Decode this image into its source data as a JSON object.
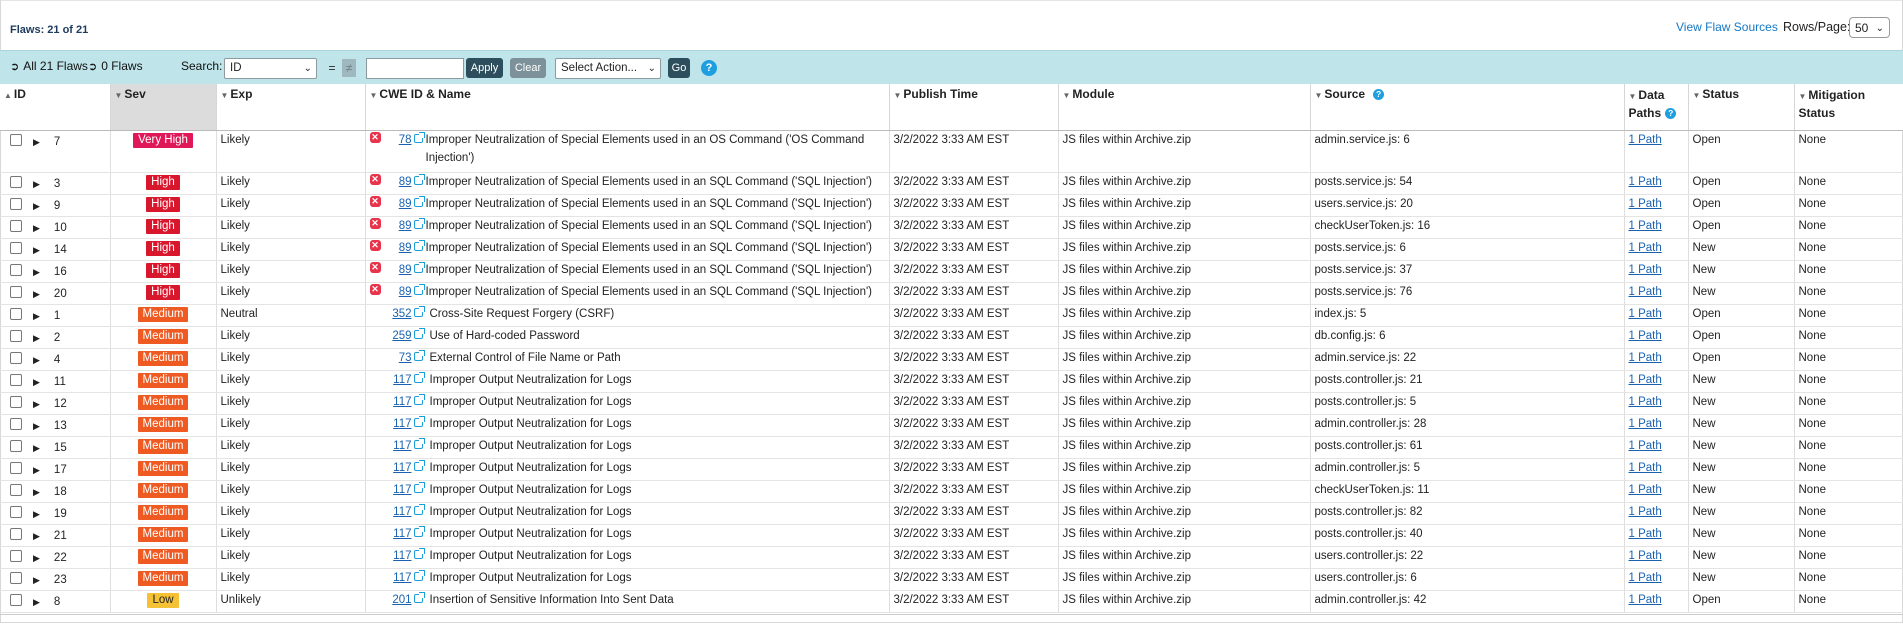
{
  "header": {
    "flaw_count": "Flaws: 21 of 21",
    "view_flaw_sources": "View Flaw Sources",
    "rows_per_page_label": "Rows/Page:",
    "rows_per_page_value": "50"
  },
  "toolbar": {
    "all_flaws": "All 21 Flaws",
    "zero_flaws": "0 Flaws",
    "search_label": "Search:",
    "search_field": "ID",
    "eq": "=",
    "neq": "≠",
    "apply": "Apply",
    "clear": "Clear",
    "action": "Select Action...",
    "go": "Go",
    "help": "?"
  },
  "columns": {
    "id": "ID",
    "sev": "Sev",
    "exp": "Exp",
    "cwe": "CWE ID & Name",
    "publish": "Publish Time",
    "module": "Module",
    "source": "Source",
    "paths": "Data Paths",
    "status": "Status",
    "mitigation": "Mitigation Status"
  },
  "rows": [
    {
      "id": "7",
      "sev": "Very High",
      "sevclass": "veryhigh",
      "exp": "Likely",
      "cwe": "78",
      "xicon": true,
      "name": "Improper Neutralization of Special Elements used in an OS Command ('OS Command Injection')",
      "time": "3/2/2022 3:33 AM EST",
      "module": "JS files within Archive.zip",
      "source": "admin.service.js: 6",
      "path": "1 Path",
      "status": "Open",
      "mit": "None"
    },
    {
      "id": "3",
      "sev": "High",
      "sevclass": "high",
      "exp": "Likely",
      "cwe": "89",
      "xicon": true,
      "name": "Improper Neutralization of Special Elements used in an SQL Command ('SQL Injection')",
      "time": "3/2/2022 3:33 AM EST",
      "module": "JS files within Archive.zip",
      "source": "posts.service.js: 54",
      "path": "1 Path",
      "status": "Open",
      "mit": "None"
    },
    {
      "id": "9",
      "sev": "High",
      "sevclass": "high",
      "exp": "Likely",
      "cwe": "89",
      "xicon": true,
      "name": "Improper Neutralization of Special Elements used in an SQL Command ('SQL Injection')",
      "time": "3/2/2022 3:33 AM EST",
      "module": "JS files within Archive.zip",
      "source": "users.service.js: 20",
      "path": "1 Path",
      "status": "Open",
      "mit": "None"
    },
    {
      "id": "10",
      "sev": "High",
      "sevclass": "high",
      "exp": "Likely",
      "cwe": "89",
      "xicon": true,
      "name": "Improper Neutralization of Special Elements used in an SQL Command ('SQL Injection')",
      "time": "3/2/2022 3:33 AM EST",
      "module": "JS files within Archive.zip",
      "source": "checkUserToken.js: 16",
      "path": "1 Path",
      "status": "Open",
      "mit": "None"
    },
    {
      "id": "14",
      "sev": "High",
      "sevclass": "high",
      "exp": "Likely",
      "cwe": "89",
      "xicon": true,
      "name": "Improper Neutralization of Special Elements used in an SQL Command ('SQL Injection')",
      "time": "3/2/2022 3:33 AM EST",
      "module": "JS files within Archive.zip",
      "source": "posts.service.js: 6",
      "path": "1 Path",
      "status": "New",
      "mit": "None"
    },
    {
      "id": "16",
      "sev": "High",
      "sevclass": "high",
      "exp": "Likely",
      "cwe": "89",
      "xicon": true,
      "name": "Improper Neutralization of Special Elements used in an SQL Command ('SQL Injection')",
      "time": "3/2/2022 3:33 AM EST",
      "module": "JS files within Archive.zip",
      "source": "posts.service.js: 37",
      "path": "1 Path",
      "status": "New",
      "mit": "None"
    },
    {
      "id": "20",
      "sev": "High",
      "sevclass": "high",
      "exp": "Likely",
      "cwe": "89",
      "xicon": true,
      "name": "Improper Neutralization of Special Elements used in an SQL Command ('SQL Injection')",
      "time": "3/2/2022 3:33 AM EST",
      "module": "JS files within Archive.zip",
      "source": "posts.service.js: 76",
      "path": "1 Path",
      "status": "New",
      "mit": "None"
    },
    {
      "id": "1",
      "sev": "Medium",
      "sevclass": "medium",
      "exp": "Neutral",
      "cwe": "352",
      "xicon": false,
      "name": "Cross-Site Request Forgery (CSRF)",
      "time": "3/2/2022 3:33 AM EST",
      "module": "JS files within Archive.zip",
      "source": "index.js: 5",
      "path": "1 Path",
      "status": "Open",
      "mit": "None"
    },
    {
      "id": "2",
      "sev": "Medium",
      "sevclass": "medium",
      "exp": "Likely",
      "cwe": "259",
      "xicon": false,
      "name": "Use of Hard-coded Password",
      "time": "3/2/2022 3:33 AM EST",
      "module": "JS files within Archive.zip",
      "source": "db.config.js: 6",
      "path": "1 Path",
      "status": "Open",
      "mit": "None"
    },
    {
      "id": "4",
      "sev": "Medium",
      "sevclass": "medium",
      "exp": "Likely",
      "cwe": "73",
      "xicon": false,
      "name": "External Control of File Name or Path",
      "time": "3/2/2022 3:33 AM EST",
      "module": "JS files within Archive.zip",
      "source": "admin.service.js: 22",
      "path": "1 Path",
      "status": "Open",
      "mit": "None"
    },
    {
      "id": "11",
      "sev": "Medium",
      "sevclass": "medium",
      "exp": "Likely",
      "cwe": "117",
      "xicon": false,
      "name": "Improper Output Neutralization for Logs",
      "time": "3/2/2022 3:33 AM EST",
      "module": "JS files within Archive.zip",
      "source": "posts.controller.js: 21",
      "path": "1 Path",
      "status": "New",
      "mit": "None"
    },
    {
      "id": "12",
      "sev": "Medium",
      "sevclass": "medium",
      "exp": "Likely",
      "cwe": "117",
      "xicon": false,
      "name": "Improper Output Neutralization for Logs",
      "time": "3/2/2022 3:33 AM EST",
      "module": "JS files within Archive.zip",
      "source": "posts.controller.js: 5",
      "path": "1 Path",
      "status": "New",
      "mit": "None"
    },
    {
      "id": "13",
      "sev": "Medium",
      "sevclass": "medium",
      "exp": "Likely",
      "cwe": "117",
      "xicon": false,
      "name": "Improper Output Neutralization for Logs",
      "time": "3/2/2022 3:33 AM EST",
      "module": "JS files within Archive.zip",
      "source": "admin.controller.js: 28",
      "path": "1 Path",
      "status": "New",
      "mit": "None"
    },
    {
      "id": "15",
      "sev": "Medium",
      "sevclass": "medium",
      "exp": "Likely",
      "cwe": "117",
      "xicon": false,
      "name": "Improper Output Neutralization for Logs",
      "time": "3/2/2022 3:33 AM EST",
      "module": "JS files within Archive.zip",
      "source": "posts.controller.js: 61",
      "path": "1 Path",
      "status": "New",
      "mit": "None"
    },
    {
      "id": "17",
      "sev": "Medium",
      "sevclass": "medium",
      "exp": "Likely",
      "cwe": "117",
      "xicon": false,
      "name": "Improper Output Neutralization for Logs",
      "time": "3/2/2022 3:33 AM EST",
      "module": "JS files within Archive.zip",
      "source": "admin.controller.js: 5",
      "path": "1 Path",
      "status": "New",
      "mit": "None"
    },
    {
      "id": "18",
      "sev": "Medium",
      "sevclass": "medium",
      "exp": "Likely",
      "cwe": "117",
      "xicon": false,
      "name": "Improper Output Neutralization for Logs",
      "time": "3/2/2022 3:33 AM EST",
      "module": "JS files within Archive.zip",
      "source": "checkUserToken.js: 11",
      "path": "1 Path",
      "status": "New",
      "mit": "None"
    },
    {
      "id": "19",
      "sev": "Medium",
      "sevclass": "medium",
      "exp": "Likely",
      "cwe": "117",
      "xicon": false,
      "name": "Improper Output Neutralization for Logs",
      "time": "3/2/2022 3:33 AM EST",
      "module": "JS files within Archive.zip",
      "source": "posts.controller.js: 82",
      "path": "1 Path",
      "status": "New",
      "mit": "None"
    },
    {
      "id": "21",
      "sev": "Medium",
      "sevclass": "medium",
      "exp": "Likely",
      "cwe": "117",
      "xicon": false,
      "name": "Improper Output Neutralization for Logs",
      "time": "3/2/2022 3:33 AM EST",
      "module": "JS files within Archive.zip",
      "source": "posts.controller.js: 40",
      "path": "1 Path",
      "status": "New",
      "mit": "None"
    },
    {
      "id": "22",
      "sev": "Medium",
      "sevclass": "medium",
      "exp": "Likely",
      "cwe": "117",
      "xicon": false,
      "name": "Improper Output Neutralization for Logs",
      "time": "3/2/2022 3:33 AM EST",
      "module": "JS files within Archive.zip",
      "source": "users.controller.js: 22",
      "path": "1 Path",
      "status": "New",
      "mit": "None"
    },
    {
      "id": "23",
      "sev": "Medium",
      "sevclass": "medium",
      "exp": "Likely",
      "cwe": "117",
      "xicon": false,
      "name": "Improper Output Neutralization for Logs",
      "time": "3/2/2022 3:33 AM EST",
      "module": "JS files within Archive.zip",
      "source": "users.controller.js: 6",
      "path": "1 Path",
      "status": "New",
      "mit": "None"
    },
    {
      "id": "8",
      "sev": "Low",
      "sevclass": "low",
      "exp": "Unlikely",
      "cwe": "201",
      "xicon": false,
      "name": "Insertion of Sensitive Information Into Sent Data",
      "time": "3/2/2022 3:33 AM EST",
      "module": "JS files within Archive.zip",
      "source": "admin.controller.js: 42",
      "path": "1 Path",
      "status": "Open",
      "mit": "None"
    }
  ]
}
